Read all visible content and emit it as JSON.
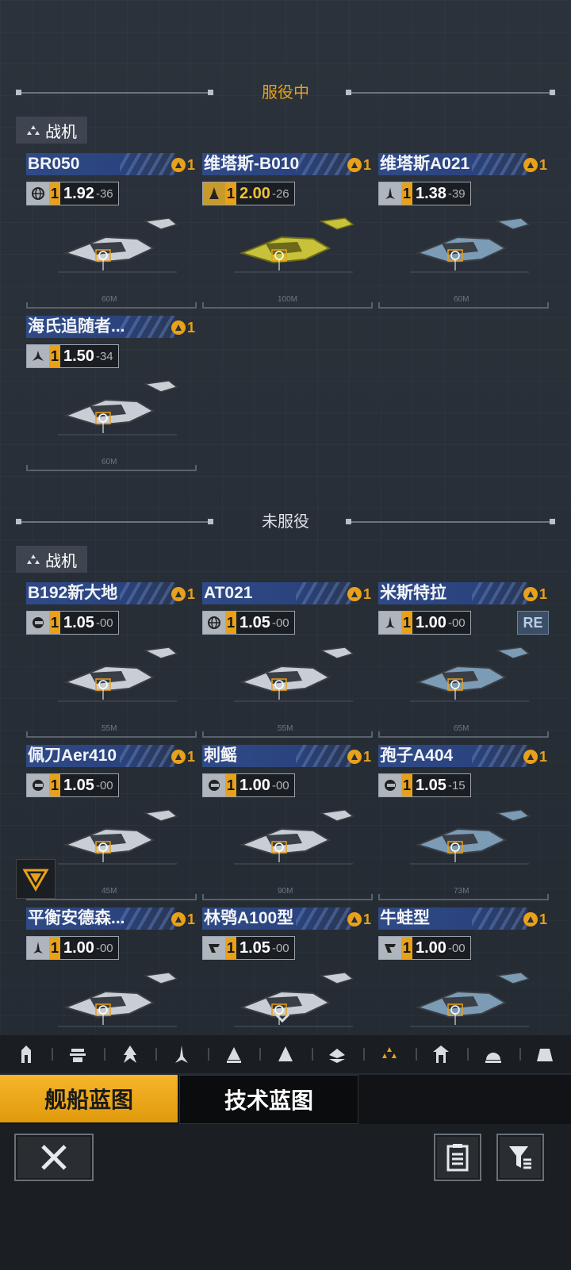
{
  "sections": {
    "active": {
      "title": "服役中",
      "category": "战机"
    },
    "inactive": {
      "title": "未服役",
      "category": "战机"
    }
  },
  "active_cards": [
    {
      "name": "BR050",
      "rank": "1",
      "class_icon": "globe-icon",
      "level": "1",
      "value": "1.92",
      "sub": "36",
      "scale": "60M"
    },
    {
      "name": "维塔斯-B010",
      "rank": "1",
      "class_icon": "flame-icon",
      "level": "1",
      "value": "2.00",
      "sub": "26",
      "scale": "100M",
      "highlight": true
    },
    {
      "name": "维塔斯A021",
      "rank": "1",
      "class_icon": "rocket-icon",
      "level": "1",
      "value": "1.38",
      "sub": "39",
      "scale": "60M"
    },
    {
      "name": "海氏追随者...",
      "rank": "1",
      "class_icon": "triad-icon",
      "level": "1",
      "value": "1.50",
      "sub": "34",
      "scale": "60M"
    }
  ],
  "inactive_cards": [
    {
      "name": "B192新大地",
      "rank": "1",
      "class_icon": "gear-icon",
      "level": "1",
      "value": "1.05",
      "sub": "00",
      "scale": "55M"
    },
    {
      "name": "AT021",
      "rank": "1",
      "class_icon": "globe-icon",
      "level": "1",
      "value": "1.05",
      "sub": "00",
      "scale": "55M"
    },
    {
      "name": "米斯特拉",
      "rank": "1",
      "class_icon": "rocket-icon",
      "level": "1",
      "value": "1.00",
      "sub": "00",
      "scale": "65M",
      "re": "RE"
    },
    {
      "name": "佩刀Aer410",
      "rank": "1",
      "class_icon": "gear-icon",
      "level": "1",
      "value": "1.05",
      "sub": "00",
      "scale": "45M"
    },
    {
      "name": "刺鳐",
      "rank": "1",
      "class_icon": "gear-icon",
      "level": "1",
      "value": "1.00",
      "sub": "00",
      "scale": "90M"
    },
    {
      "name": "孢子A404",
      "rank": "1",
      "class_icon": "gear-icon",
      "level": "1",
      "value": "1.05",
      "sub": "15",
      "scale": "73M"
    },
    {
      "name": "平衡安德森...",
      "rank": "1",
      "class_icon": "rocket-icon",
      "level": "1",
      "value": "1.00",
      "sub": "00",
      "scale": ""
    },
    {
      "name": "林鸮A100型",
      "rank": "1",
      "class_icon": "shield-icon",
      "level": "1",
      "value": "1.05",
      "sub": "00",
      "scale": ""
    },
    {
      "name": "牛蛙型",
      "rank": "1",
      "class_icon": "shield-icon",
      "level": "1",
      "value": "1.00",
      "sub": "00",
      "scale": ""
    }
  ],
  "tabbar": [
    "station-icon",
    "carrier-icon",
    "cruiser-icon",
    "destroyer-icon",
    "frigate-icon",
    "corvette-icon",
    "bomber-icon",
    "fighter-icon",
    "gate-icon",
    "dome-icon",
    "bunker-icon"
  ],
  "active_tab_index": 7,
  "blueprint_tabs": {
    "ship": "舰船蓝图",
    "tech": "技术蓝图"
  },
  "colors": {
    "accent": "#e8a11a",
    "namebar": "#2f4a86",
    "bg": "#252b33"
  }
}
